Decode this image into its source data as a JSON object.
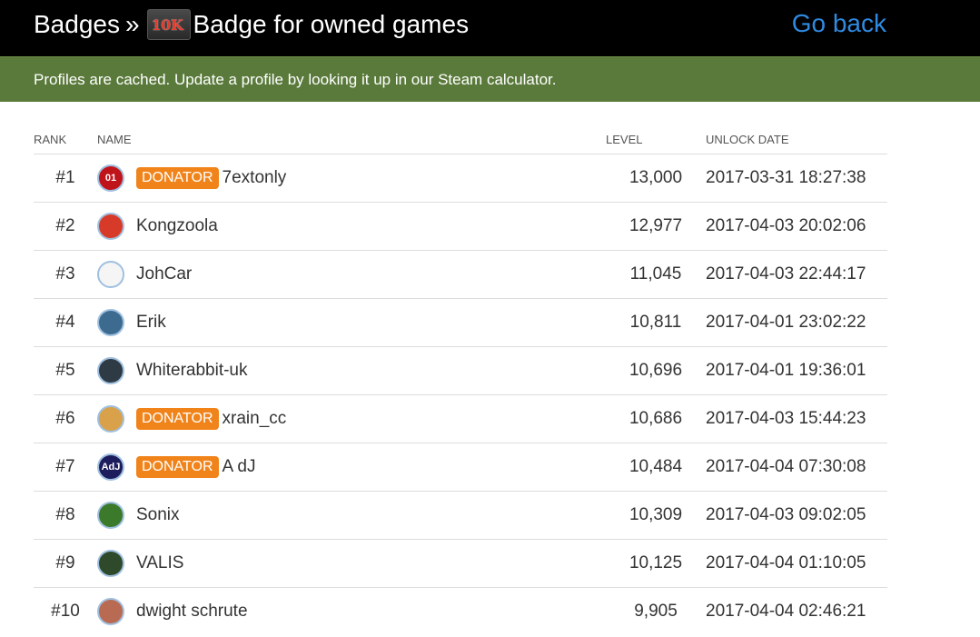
{
  "header": {
    "breadcrumb_root": "Badges",
    "separator": "»",
    "badge_icon_text": "10K",
    "badge_title": "Badge for owned games",
    "go_back": "Go back"
  },
  "notice": "Profiles are cached. Update a profile by looking it up in our Steam calculator.",
  "table": {
    "columns": [
      "RANK",
      "NAME",
      "LEVEL",
      "UNLOCK DATE"
    ],
    "donator_label": "DONATOR",
    "rows": [
      {
        "rank": "#1",
        "name": "7extonly",
        "donator": true,
        "level": "13,000",
        "date": "2017-03-31 18:27:38",
        "avatar_color": "#c0141b",
        "avatar_text": "01"
      },
      {
        "rank": "#2",
        "name": "Kongzoola",
        "donator": false,
        "level": "12,977",
        "date": "2017-04-03 20:02:06",
        "avatar_color": "#d83a2a",
        "avatar_text": ""
      },
      {
        "rank": "#3",
        "name": "JohCar",
        "donator": false,
        "level": "11,045",
        "date": "2017-04-03 22:44:17",
        "avatar_color": "#f5f5f5",
        "avatar_text": ""
      },
      {
        "rank": "#4",
        "name": "Erik",
        "donator": false,
        "level": "10,811",
        "date": "2017-04-01 23:02:22",
        "avatar_color": "#3d6b8f",
        "avatar_text": ""
      },
      {
        "rank": "#5",
        "name": "Whiterabbit-uk",
        "donator": false,
        "level": "10,696",
        "date": "2017-04-01 19:36:01",
        "avatar_color": "#2f3b44",
        "avatar_text": ""
      },
      {
        "rank": "#6",
        "name": "xrain_cc",
        "donator": true,
        "level": "10,686",
        "date": "2017-04-03 15:44:23",
        "avatar_color": "#d9a14a",
        "avatar_text": ""
      },
      {
        "rank": "#7",
        "name": "A dJ",
        "donator": true,
        "level": "10,484",
        "date": "2017-04-04 07:30:08",
        "avatar_color": "#1d1d5e",
        "avatar_text": "AdJ"
      },
      {
        "rank": "#8",
        "name": "Sonix",
        "donator": false,
        "level": "10,309",
        "date": "2017-04-03 09:02:05",
        "avatar_color": "#3a7a2a",
        "avatar_text": ""
      },
      {
        "rank": "#9",
        "name": "VALIS",
        "donator": false,
        "level": "10,125",
        "date": "2017-04-04 01:10:05",
        "avatar_color": "#2e4a2a",
        "avatar_text": ""
      },
      {
        "rank": "#10",
        "name": "dwight schrute",
        "donator": false,
        "level": "9,905",
        "date": "2017-04-04 02:46:21",
        "avatar_color": "#b86a52",
        "avatar_text": ""
      }
    ]
  }
}
